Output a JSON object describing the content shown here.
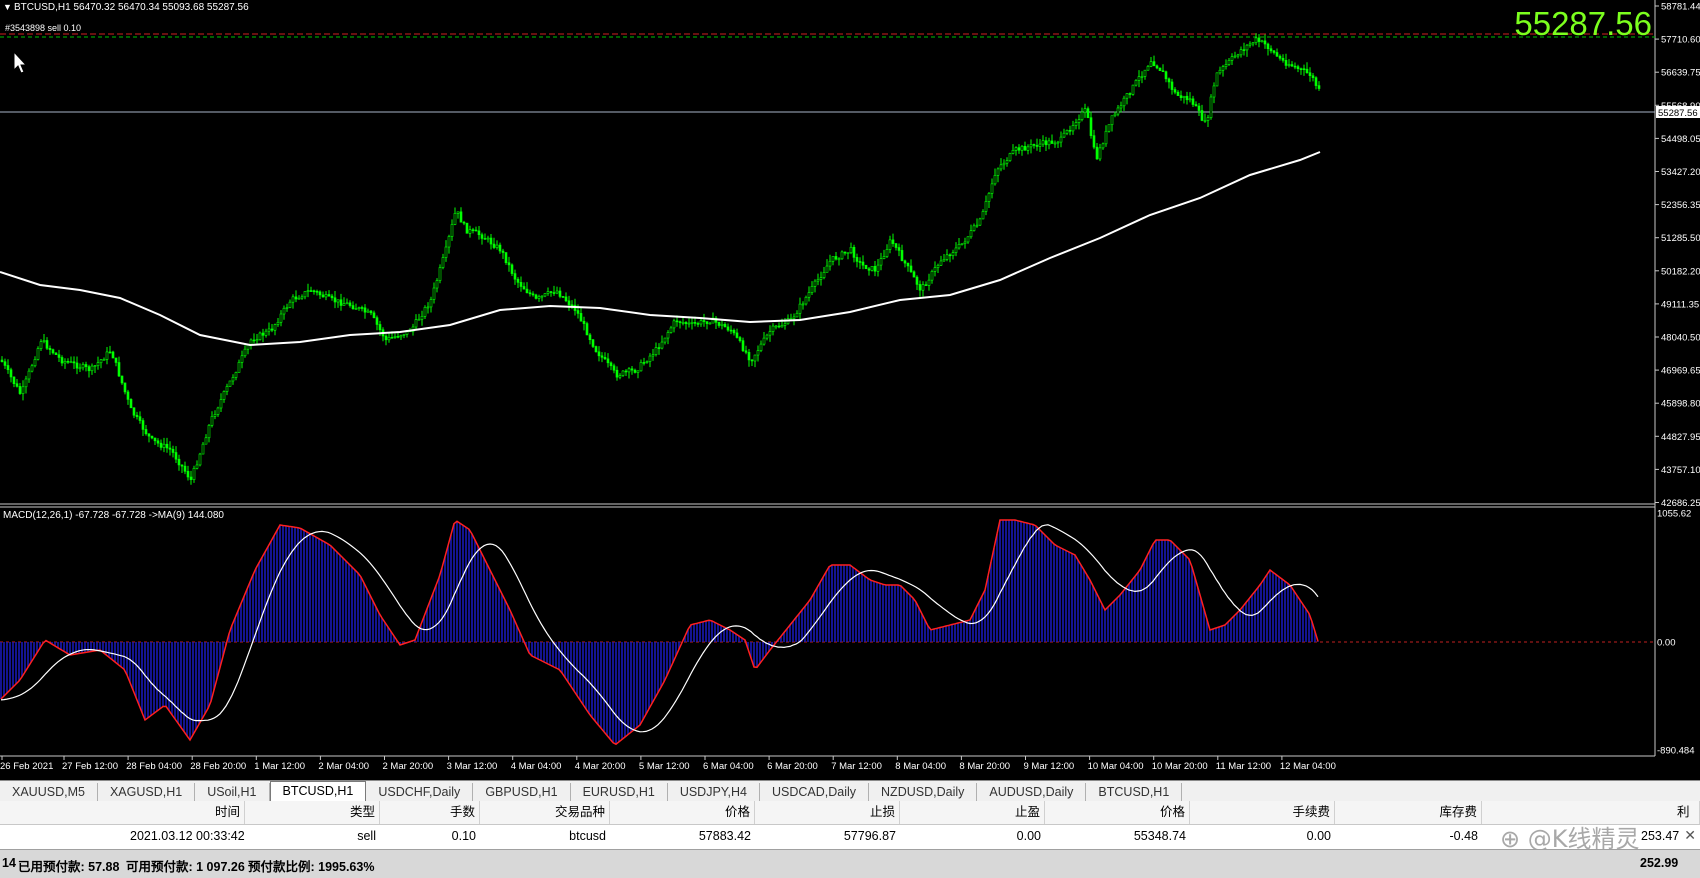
{
  "window": {
    "symbol_header": "BTCUSD,H1  56470.32 56470.34 55093.68 55287.56",
    "order_label": "#3543898 sell 0.10",
    "big_price": "55287.56",
    "price_badge": "55287.56",
    "macd_label": "MACD(12,26,1) -67.728 -67.728  ->MA(9) 144.080"
  },
  "colors": {
    "bull": "#00ff00",
    "bear": "#ffffff",
    "ma_line": "#ffffff",
    "macd_hist": "#1a1ab4",
    "macd_line": "#ff2020",
    "signal_line": "#ffffff",
    "big_price": "#7cff1e",
    "order_line": "#d02020",
    "sl_line": "#00c000"
  },
  "price_axis": [
    "58781.44",
    "57710.60",
    "56639.75",
    "55568.90",
    "54498.05",
    "53427.20",
    "52356.35",
    "51285.50",
    "50182.20",
    "49111.35",
    "48040.50",
    "46969.65",
    "45898.80",
    "44827.95",
    "43757.10",
    "42686.25"
  ],
  "macd_axis": [
    "1055.62",
    "0.00",
    "-890.484"
  ],
  "time_axis": [
    "26 Feb 2021",
    "27 Feb 12:00",
    "28 Feb 04:00",
    "28 Feb 20:00",
    "1 Mar 12:00",
    "2 Mar 04:00",
    "2 Mar 20:00",
    "3 Mar 12:00",
    "4 Mar 04:00",
    "4 Mar 20:00",
    "5 Mar 12:00",
    "6 Mar 04:00",
    "6 Mar 20:00",
    "7 Mar 12:00",
    "8 Mar 04:00",
    "8 Mar 20:00",
    "9 Mar 12:00",
    "10 Mar 04:00",
    "10 Mar 20:00",
    "11 Mar 12:00",
    "12 Mar 04:00"
  ],
  "tabs": [
    "XAUUSD,M5",
    "XAGUSD,H1",
    "USoil,H1",
    "BTCUSD,H1",
    "USDCHF,Daily",
    "GBPUSD,H1",
    "EURUSD,H1",
    "USDJPY,H4",
    "USDCAD,Daily",
    "NZDUSD,Daily",
    "AUDUSD,Daily",
    "BTCUSD,H1"
  ],
  "active_tab": 3,
  "terminal": {
    "headers": [
      "时间",
      "类型",
      "手数",
      "交易品种",
      "价格",
      "止损",
      "止盈",
      "价格",
      "手续费",
      "库存费",
      "利"
    ],
    "row": [
      "2021.03.12 00:33:42",
      "sell",
      "0.10",
      "btcusd",
      "57883.42",
      "57796.87",
      "0.00",
      "55348.74",
      "0.00",
      "-0.48",
      "253.47"
    ],
    "status_prefix": "14",
    "status_used": "已用预付款: 57.88",
    "status_free": "可用预付款: 1 097.26",
    "status_ratio": "预付款比例: 1995.63%",
    "status_total": "252.99"
  },
  "watermark": "⊕ @K线精灵"
}
